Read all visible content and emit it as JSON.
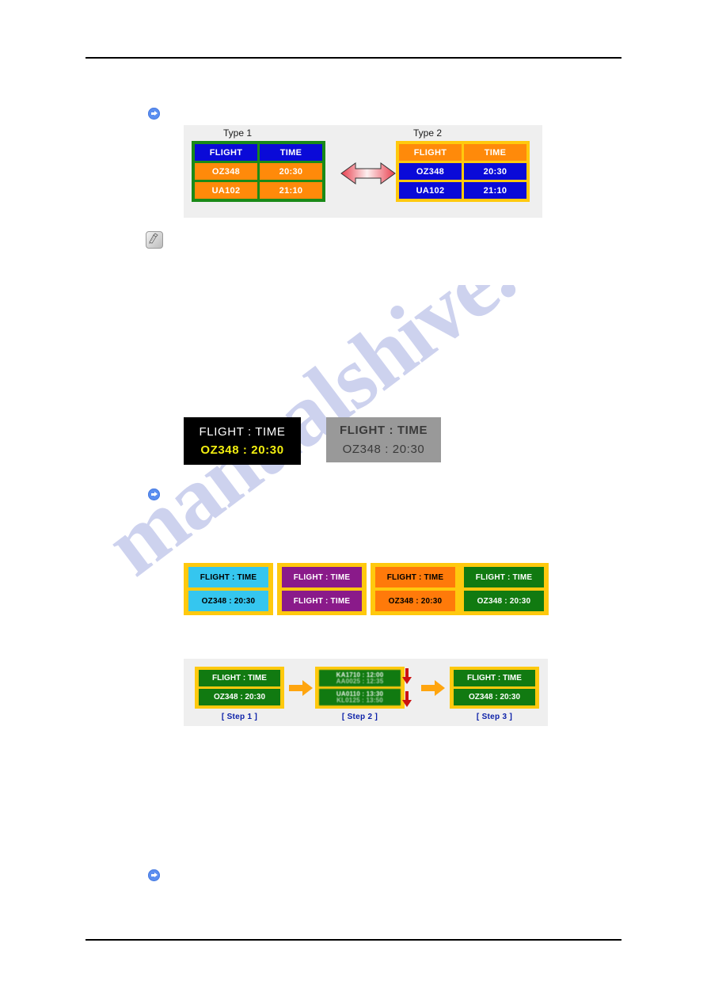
{
  "page": {
    "background": "#ffffff",
    "rule_color": "#000000",
    "watermark_text": "manualshive.com"
  },
  "icons": {
    "bullet_arrow": "blue-circle-arrow-icon",
    "note": "note-pencil-icon"
  },
  "figure_types": {
    "caption_left": "Type 1",
    "caption_right": "Type 2",
    "swap_icon": "double-headed-arrow-icon",
    "colors": {
      "type1_border": "#1a8a18",
      "type2_border": "#ffc90e",
      "blue": "#0a0ad8",
      "orange": "#ff8a0a",
      "panel_bg": "#efefef"
    },
    "type1": {
      "header": [
        "FLIGHT",
        "TIME"
      ],
      "rows": [
        [
          "OZ348",
          "20:30"
        ],
        [
          "UA102",
          "21:10"
        ]
      ]
    },
    "type2": {
      "header": [
        "FLIGHT",
        "TIME"
      ],
      "rows": [
        [
          "OZ348",
          "20:30"
        ],
        [
          "UA102",
          "21:10"
        ]
      ]
    }
  },
  "figure_contrast": {
    "black_panel": {
      "line1": "FLIGHT  :  TIME",
      "line2": "OZ348    :  20:30",
      "background": "#000000",
      "line1_color": "#ffffff",
      "line2_color": "#f2ee10"
    },
    "grey_panel": {
      "line1": "FLIGHT  :  TIME",
      "line2": "OZ348    :  20:30",
      "background": "#999999",
      "text_color": "#3a3a3a"
    }
  },
  "figure_colors": {
    "border_color": "#ffc90e",
    "panels": [
      {
        "name": "cyan-panel",
        "bg": "#35c6ef",
        "text_color": "#000000",
        "line1": "FLIGHT  :  TIME",
        "line2": "OZ348    :  20:30"
      },
      {
        "name": "purple-panel",
        "bg": "#8a1a8a",
        "text_color": "#ffffff",
        "line1": "FLIGHT  :  TIME",
        "line2": "FLIGHT  :  TIME"
      },
      {
        "name": "orange-panel",
        "bg": "#ff7a0a",
        "text_color": "#000000",
        "line1": "FLIGHT  :  TIME",
        "line2": "OZ348    :  20:30"
      },
      {
        "name": "green-panel",
        "bg": "#117a11",
        "text_color": "#ffffff",
        "line1": "FLIGHT  :  TIME",
        "line2": "OZ348    :  20:30"
      }
    ]
  },
  "figure_steps": {
    "panel_bg": "#efefef",
    "border_color": "#ffc90e",
    "screen_color": "#117a11",
    "arrow_color": "#ffa50f",
    "scroll_arrow_color": "#cc1111",
    "label_color": "#0a1fa8",
    "steps": [
      {
        "label": "[ Step 1 ]",
        "line1": "FLIGHT  :  TIME",
        "line2": "OZ348    :  20:30",
        "blurred": false
      },
      {
        "label": "[ Step 2 ]",
        "line1_a": "KA1710  :  12:00",
        "line1_b": "AA0025  :  12:35",
        "line2_a": "UA0110  :  13:30",
        "line2_b": "KL0125  :  13:50",
        "blurred": true
      },
      {
        "label": "[ Step 3 ]",
        "line1": "FLIGHT  :  TIME",
        "line2": "OZ348    :  20:30",
        "blurred": false
      }
    ]
  }
}
